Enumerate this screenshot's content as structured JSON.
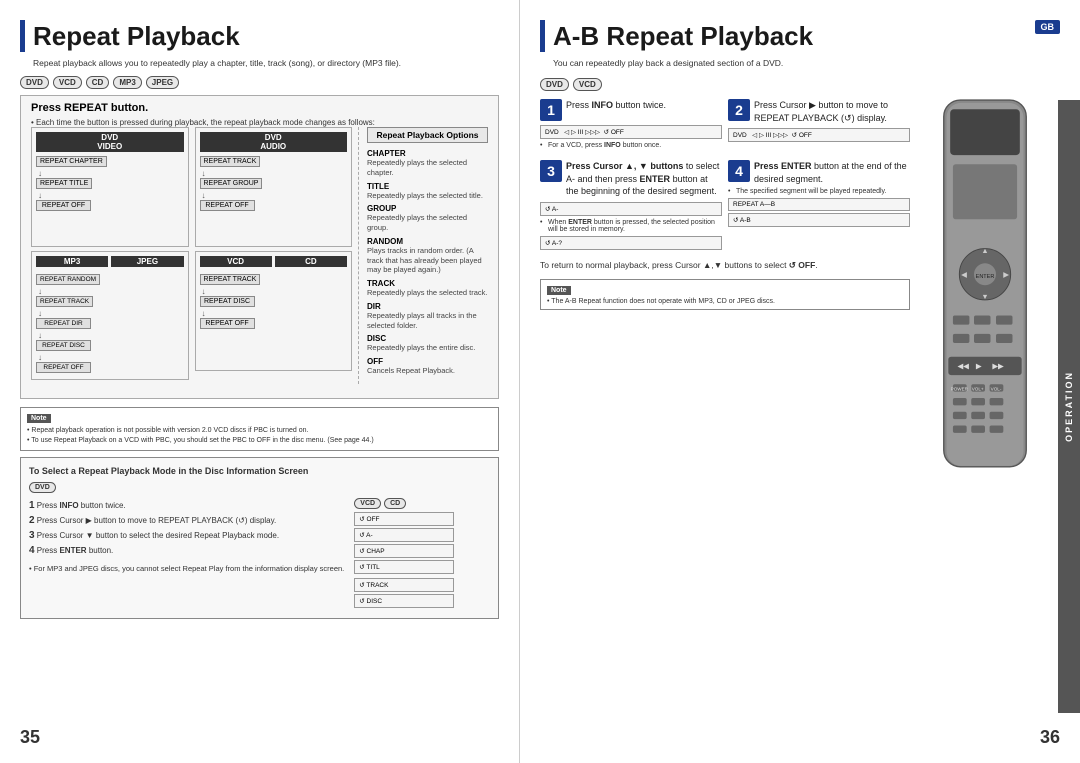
{
  "leftPage": {
    "title": "Repeat Playback",
    "subtitle": "Repeat playback allows you to repeatedly play a chapter, title, track (song), or directory (MP3 file).",
    "formats": [
      "DVD",
      "VCD",
      "CD",
      "MP3",
      "JPEG"
    ],
    "repeatBox": {
      "title": "Press REPEAT button.",
      "desc": "• Each time the button is pressed during playback, the repeat playback mode changes as follows:"
    },
    "dvdVideo": {
      "title": "DVD VIDEO",
      "items": [
        "REPEAT CHAPTER",
        "REPEAT TITLE",
        "REPEAT OFF"
      ]
    },
    "dvdAudio": {
      "title": "DVD AUDIO",
      "items": [
        "REPEAT TRACK",
        "REPEAT GROUP",
        "REPEAT OFF"
      ]
    },
    "mp3": {
      "title": "MP3",
      "items": [
        "REPEAT RANDOM",
        "REPEAT TRACK",
        "REPEAT DIR",
        "REPEAT DISC",
        "REPEAT OFF"
      ]
    },
    "jpeg": {
      "title": "JPEG",
      "items": []
    },
    "vcd": {
      "title": "VCD",
      "items": [
        "REPEAT TRACK",
        "REPEAT DISC",
        "REPEAT OFF"
      ]
    },
    "cd": {
      "title": "CD",
      "items": []
    },
    "options": {
      "title": "Repeat Playback Options",
      "items": [
        {
          "name": "CHAPTER",
          "desc": "Repeatedly plays the selected chapter."
        },
        {
          "name": "TITLE",
          "desc": "Repeatedly plays the selected title."
        },
        {
          "name": "GROUP",
          "desc": "Repeatedly plays the selected group."
        },
        {
          "name": "RANDOM",
          "desc": "Plays tracks in random order. (A track that has already been played may be played again.)"
        },
        {
          "name": "TRACK",
          "desc": "Repeatedly plays the selected track."
        },
        {
          "name": "DIR",
          "desc": "Repeatedly plays all tracks in the selected folder."
        },
        {
          "name": "DISC",
          "desc": "Repeatedly plays the entire disc."
        },
        {
          "name": "OFF",
          "desc": "Cancels Repeat Playback."
        }
      ]
    },
    "selectBox": {
      "title": "To Select a Repeat Playback Mode in the Disc Information Screen",
      "steps": [
        {
          "num": "1",
          "text": "Press INFO button twice."
        },
        {
          "num": "2",
          "text": "Press Cursor ▶ button to move to REPEAT PLAYBACK (↺) display."
        },
        {
          "num": "3",
          "text": "Press Cursor ▼ button to select the desired Repeat Playback mode."
        },
        {
          "num": "4",
          "text": "Press ENTER button."
        }
      ],
      "footNote": "• For MP3 and JPEG discs, you cannot select Repeat Play from the information display screen."
    },
    "note": {
      "title": "Note",
      "items": [
        "Repeat playback operation is not possible with version 2.0 VCD discs if PBC is turned on.",
        "To use Repeat Playback on a VCD with PBC, you should set the PBC to OFF in the disc menu. (See page 44.)"
      ]
    },
    "pageNumber": "35"
  },
  "rightPage": {
    "title": "A-B Repeat Playback",
    "gbBadge": "GB",
    "subtitle": "You can repeatedly play back a designated section of a DVD.",
    "formats": [
      "DVD",
      "VCD"
    ],
    "step1": {
      "num": "1",
      "text": "Press INFO button twice."
    },
    "step2": {
      "num": "2",
      "text": "Press Cursor ▶ button to move to REPEAT PLAYBACK (↺) display."
    },
    "step3": {
      "num": "3",
      "textBold": "Press Cursor ▲, ▼ buttons",
      "text": "to select A- and then press ENTER button at the beginning of the desired segment."
    },
    "step4": {
      "num": "4",
      "textBold": "Press ENTER",
      "text": "button at the end of the desired segment."
    },
    "bulletNote1": "For a VCD, press INFO button once.",
    "bulletNote2": "When ENTER button is pressed, the selected position will be stored in memory.",
    "bulletNote3": "The specified segment will be played repeatedly.",
    "returnText": "To return to normal playback, press Cursor ▲,▼ buttons to select ↺ OFF.",
    "note": {
      "title": "Note",
      "text": "• The A-B Repeat function does not operate with MP3, CD or JPEG discs."
    },
    "operation": "OPERATION",
    "pageNumber": "36"
  }
}
